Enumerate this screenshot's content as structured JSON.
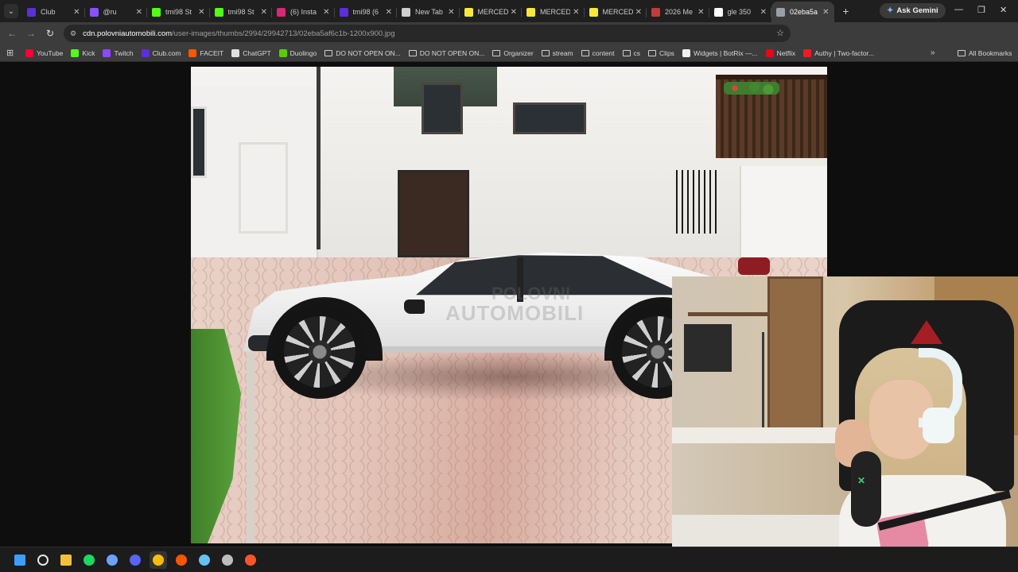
{
  "tabs": [
    {
      "title": "Club",
      "color": "#5b2fd9",
      "active": false
    },
    {
      "title": "@ru",
      "color": "#8a4fff",
      "active": false
    },
    {
      "title": "tmi98 St",
      "color": "#53fc18",
      "active": false
    },
    {
      "title": "tmi98 St",
      "color": "#53fc18",
      "active": false
    },
    {
      "title": "(6) Insta",
      "color": "#d62976",
      "active": false
    },
    {
      "title": "tmi98 (6",
      "color": "#5b2fd9",
      "active": false
    },
    {
      "title": "New Tab",
      "color": "#cfcfcf",
      "active": false
    },
    {
      "title": "MERCED",
      "color": "#f7e83b",
      "active": false
    },
    {
      "title": "MERCED",
      "color": "#f7e83b",
      "active": false
    },
    {
      "title": "MERCED",
      "color": "#f7e83b",
      "active": false
    },
    {
      "title": "2026 Me",
      "color": "#c43a3a",
      "active": false
    },
    {
      "title": "gle 350",
      "color": "#ffffff",
      "active": false
    },
    {
      "title": "02eba5a",
      "color": "#9aa0a6",
      "active": true
    }
  ],
  "gemini_label": "Ask Gemini",
  "address": {
    "host": "cdn.polovniautomobili.com",
    "path": "/user-images/thumbs/2994/29942713/02eba5af6c1b-1200x900.jpg"
  },
  "bookmarks": [
    {
      "label": "YouTube",
      "color": "#ff0033",
      "folder": false
    },
    {
      "label": "Kick",
      "color": "#53fc18",
      "folder": false
    },
    {
      "label": "Twitch",
      "color": "#9146ff",
      "folder": false
    },
    {
      "label": "Club.com",
      "color": "#5b2fd9",
      "folder": false
    },
    {
      "label": "FACEIT",
      "color": "#ff5500",
      "folder": false
    },
    {
      "label": "ChatGPT",
      "color": "#e0e0e0",
      "folder": false
    },
    {
      "label": "Duolingo",
      "color": "#58cc02",
      "folder": false
    },
    {
      "label": "DO NOT OPEN ON...",
      "color": "",
      "folder": true
    },
    {
      "label": "DO NOT OPEN ON...",
      "color": "",
      "folder": true
    },
    {
      "label": "Organizer",
      "color": "",
      "folder": true
    },
    {
      "label": "stream",
      "color": "",
      "folder": true
    },
    {
      "label": "content",
      "color": "",
      "folder": true
    },
    {
      "label": "cs",
      "color": "",
      "folder": true
    },
    {
      "label": "Clips",
      "color": "",
      "folder": true
    },
    {
      "label": "Widgets | BotRix —...",
      "color": "#f0f0f0",
      "folder": false
    },
    {
      "label": "Netflix",
      "color": "#e50914",
      "folder": false
    },
    {
      "label": "Authy | Two-factor...",
      "color": "#ec1c24",
      "folder": false
    }
  ],
  "all_bookmarks_label": "All Bookmarks",
  "watermark": {
    "line1": "POLOVNI",
    "line2": "AUTOMOBILI"
  },
  "taskbar": [
    {
      "name": "windows-start-icon",
      "color": "#3aa0ff"
    },
    {
      "name": "search-icon",
      "color": "#e6e6e6"
    },
    {
      "name": "file-explorer-icon",
      "color": "#f3c13a"
    },
    {
      "name": "spotify-icon",
      "color": "#1ed760"
    },
    {
      "name": "app-icon",
      "color": "#6aa3ff"
    },
    {
      "name": "discord-icon",
      "color": "#5865f2"
    },
    {
      "name": "chrome-icon",
      "color": "#fbbc04"
    },
    {
      "name": "faceit-icon",
      "color": "#ff5500"
    },
    {
      "name": "steam-icon",
      "color": "#66c0f4"
    },
    {
      "name": "app-icon-2",
      "color": "#bdbdbd"
    },
    {
      "name": "brave-icon",
      "color": "#fb542b"
    }
  ]
}
